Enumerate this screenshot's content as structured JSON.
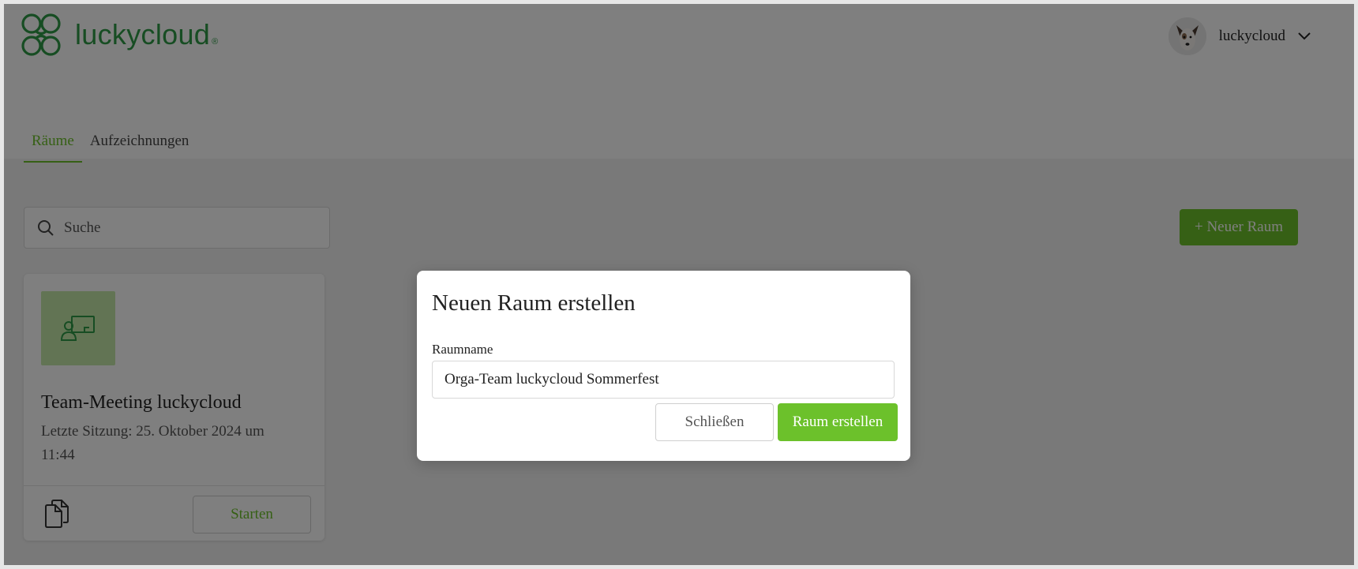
{
  "brand": {
    "name": "luckycloud",
    "registered": "®",
    "color": "#2e9a46"
  },
  "user": {
    "name": "luckycloud",
    "avatar_icon": "dog-avatar",
    "menu_icon": "chevron-down-icon"
  },
  "tabs": [
    {
      "label": "Räume",
      "active": true
    },
    {
      "label": "Aufzeichnungen",
      "active": false
    }
  ],
  "search": {
    "placeholder": "Suche",
    "value": "",
    "icon": "search-icon"
  },
  "new_room_button": {
    "label": "+ Neuer Raum"
  },
  "rooms": [
    {
      "title": "Team-Meeting luckycloud",
      "meta": "Letzte Sitzung: 25. Oktober 2024 um 11:44",
      "thumb_icon": "presentation-icon",
      "copy_icon": "copy-icon",
      "start_label": "Starten"
    }
  ],
  "modal": {
    "title": "Neuen Raum erstellen",
    "field_label": "Raumname",
    "field_value": "Orga-Team luckycloud Sommerfest",
    "close_label": "Schließen",
    "create_label": "Raum erstellen"
  },
  "colors": {
    "accent": "#6cc12b",
    "overlay": "rgba(0,0,0,0.5)"
  }
}
